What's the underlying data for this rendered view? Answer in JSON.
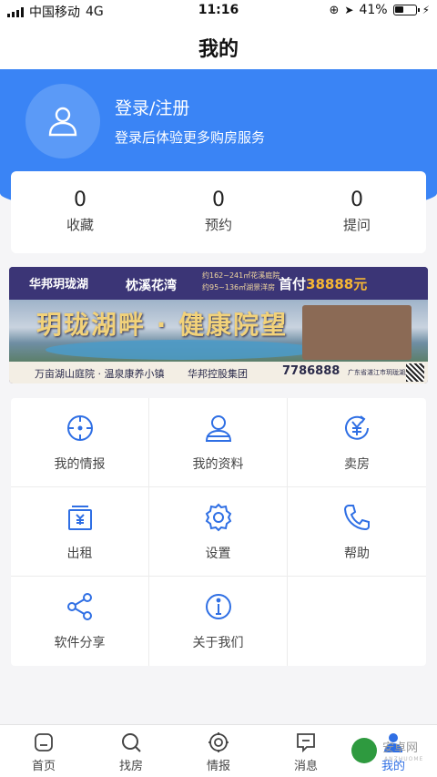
{
  "status_bar": {
    "carrier": "中国移动",
    "network": "4G",
    "time": "11:16",
    "battery_percent": "41%",
    "battery_level": 0.41
  },
  "nav": {
    "title": "我的"
  },
  "profile": {
    "login_title": "登录/注册",
    "login_subtitle": "登录后体验更多购房服务",
    "avatar_icon": "user-icon"
  },
  "stats": [
    {
      "value": "0",
      "label": "收藏"
    },
    {
      "value": "0",
      "label": "预约"
    },
    {
      "value": "0",
      "label": "提问"
    }
  ],
  "banner": {
    "brand": "华邦玥珑湖",
    "project": "枕溪花湾",
    "area_line1": "约162~241㎡花溪庭院",
    "area_line2": "约95~136㎡湖景洋房",
    "down_payment_label": "首付",
    "down_payment_amount": "38888元",
    "headline": "玥珑湖畔 · 健康院望",
    "tagline_left": "万亩湖山庭院 · 温泉康养小镇",
    "tagline_mid": "华邦控股集团",
    "phone": "7786888",
    "address": "广东省湛江市玥珑湖风景区"
  },
  "menu": [
    {
      "label": "我的情报",
      "icon": "crosshair-icon"
    },
    {
      "label": "我的资料",
      "icon": "profile-icon"
    },
    {
      "label": "卖房",
      "icon": "yuan-refresh-icon"
    },
    {
      "label": "出租",
      "icon": "rent-box-icon"
    },
    {
      "label": "设置",
      "icon": "gear-icon"
    },
    {
      "label": "帮助",
      "icon": "phone-icon"
    },
    {
      "label": "软件分享",
      "icon": "share-icon"
    },
    {
      "label": "关于我们",
      "icon": "info-icon"
    }
  ],
  "tabs": [
    {
      "label": "首页",
      "icon": "home-icon"
    },
    {
      "label": "找房",
      "icon": "search-icon"
    },
    {
      "label": "情报",
      "icon": "target-icon"
    },
    {
      "label": "消息",
      "icon": "message-icon"
    },
    {
      "label": "我的",
      "icon": "user-icon",
      "active": true
    }
  ],
  "watermark": {
    "text": "安卓网",
    "sub": "ANZHUOME"
  },
  "colors": {
    "primary": "#3a84f5",
    "icon_blue": "#2f6fe4",
    "tab_active": "#2f6fe4"
  }
}
